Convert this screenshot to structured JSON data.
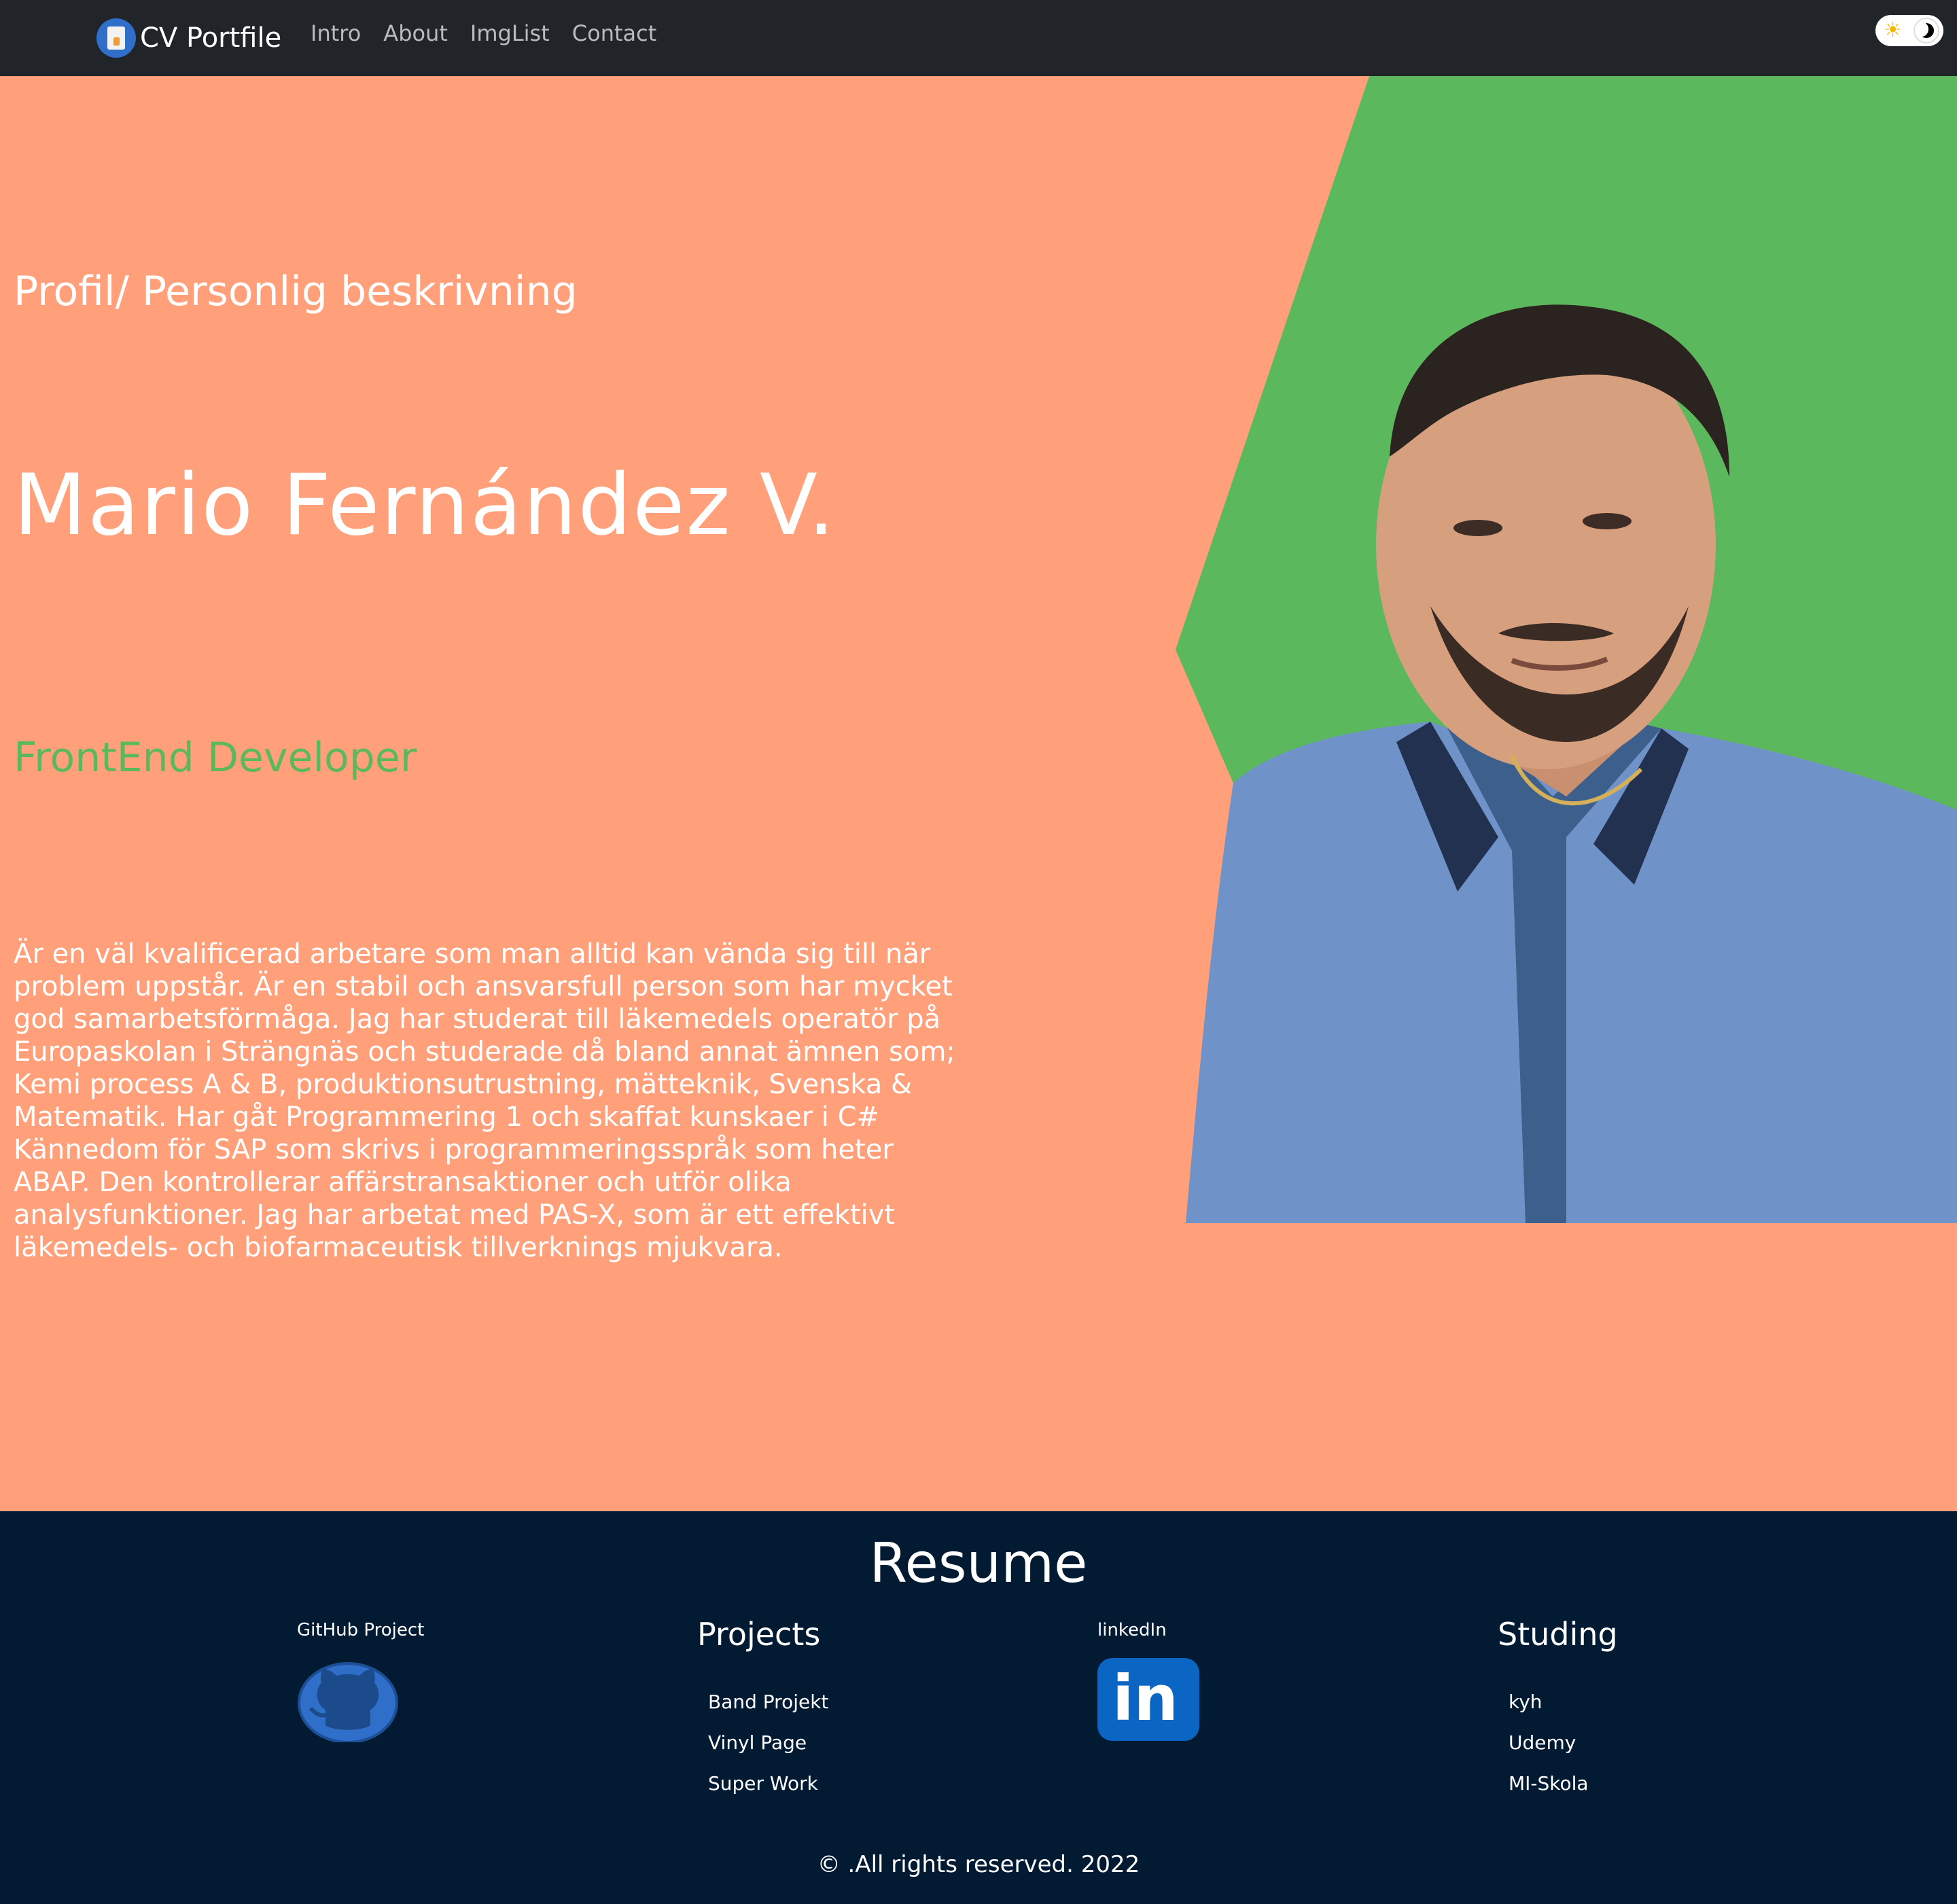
{
  "navbar": {
    "brand": "CV Portfile",
    "links": [
      "Intro",
      "About",
      "ImgList",
      "Contact"
    ],
    "brand_icon": "cv-document-icon",
    "toggle_icons": [
      "sun-icon",
      "moon-icon"
    ]
  },
  "hero": {
    "subtitle": "Profil/ Personlig beskrivning",
    "name": "Mario Fernández V.",
    "role": "FrontEnd Developer",
    "description": "Är en väl kvalificerad arbetare som man alltid kan vända sig till när problem uppstår. Är en stabil och ansvarsfull person som har mycket god samarbetsförmåga. Jag har studerat till läkemedels operatör på Europaskolan i Strängnäs och studerade då bland annat ämnen som; Kemi process A & B, produktionsutrustning, mätteknik, Svenska & Matematik. Har gåt Programmering 1 och skaffat kunskaer i C# Kännedom för SAP som skrivs i programmeringsspråk som heter ABAP. Den kontrollerar affärstransaktioner och utför olika analysfunktioner. Jag har arbetat med PAS-X, som är ett effektivt läkemedels- och biofarmaceutisk tillverknings mjukvara.",
    "portrait_icon": "portrait-photo",
    "colors": {
      "background": "#ffa07a",
      "accent_shape": "#5cb85c",
      "role_text": "#5cb85c"
    }
  },
  "footer": {
    "title": "Resume",
    "github": {
      "title": "GitHub Project",
      "icon": "github-icon"
    },
    "projects": {
      "title": "Projects",
      "links": [
        "Band Projekt",
        "Vinyl Page",
        "Super Work"
      ]
    },
    "linkedin": {
      "title": "linkedIn",
      "icon": "linkedin-icon",
      "icon_text": "in"
    },
    "studing": {
      "title": "Studing",
      "links": [
        "kyh",
        "Udemy",
        "MI-Skola"
      ]
    },
    "copyright": "© .All rights reserved. 2022",
    "colors": {
      "background": "#031a33"
    }
  }
}
